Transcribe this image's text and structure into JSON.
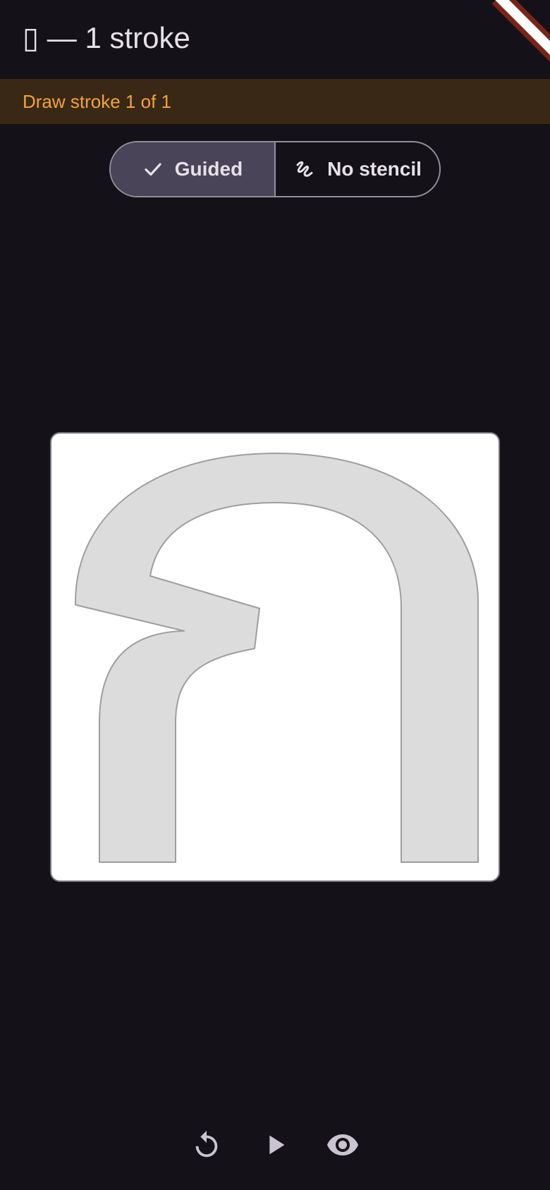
{
  "appbar": {
    "title": "▯ — 1 stroke"
  },
  "status": {
    "text": "Draw stroke 1 of 1",
    "color": "#F2A33A",
    "background": "#3A2816"
  },
  "mode_toggle": {
    "guided_label": "Guided",
    "guided_icon": "check-icon",
    "guided_selected": true,
    "freehand_label": "No stencil",
    "freehand_icon": "gesture-icon"
  },
  "canvas": {
    "character_outline_color": "#9E9E9E",
    "character_fill_color": "#DCDCDC",
    "background": "#FFFFFF"
  },
  "controls": {
    "reset_icon": "replay-icon",
    "play_icon": "play-icon",
    "show_icon": "eye-icon"
  },
  "theme": {
    "background": "#141218",
    "text": "#E6E0E9",
    "selected_segment": "#4A4458",
    "outline": "#938F99"
  }
}
